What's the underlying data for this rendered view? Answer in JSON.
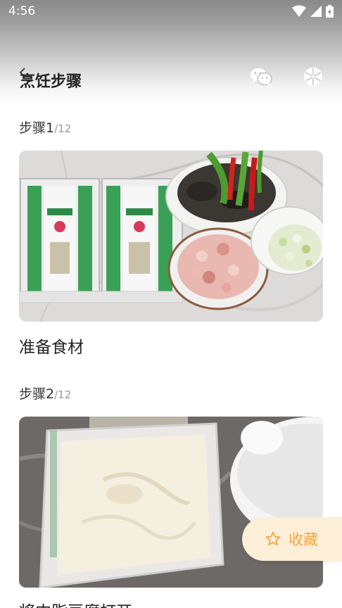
{
  "status_bar": {
    "time": "4:56"
  },
  "header": {
    "title": "烹饪步骤"
  },
  "steps": [
    {
      "step": "步骤1",
      "total": "/12",
      "description": "准备食材"
    },
    {
      "step": "步骤2",
      "total": "/12",
      "description": "将内脂豆腐打开"
    }
  ],
  "favorite": {
    "label": "收藏"
  },
  "colors": {
    "accent": "#f4a640",
    "favorite_bg": "#fdeed8"
  }
}
